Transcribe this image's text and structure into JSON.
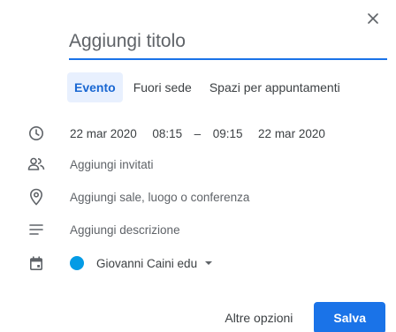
{
  "dialog": {
    "close_label": "×",
    "title_placeholder": "Aggiungi titolo"
  },
  "tabs": [
    {
      "label": "Evento",
      "active": true
    },
    {
      "label": "Fuori sede",
      "active": false
    },
    {
      "label": "Spazi per appuntamenti",
      "active": false
    }
  ],
  "datetime": {
    "start_date": "22 mar 2020",
    "start_time": "08:15",
    "separator": "–",
    "end_time": "09:15",
    "end_date": "22 mar 2020"
  },
  "guests": {
    "placeholder": "Aggiungi invitati"
  },
  "location": {
    "placeholder": "Aggiungi sale, luogo o conferenza"
  },
  "description": {
    "placeholder": "Aggiungi descrizione"
  },
  "calendar": {
    "name": "Giovanni Caini edu",
    "color": "#039be5"
  },
  "footer": {
    "more_options_label": "Altre opzioni",
    "save_label": "Salva"
  },
  "colors": {
    "accent": "#1a73e8",
    "active_tab_bg": "#e8f0fe",
    "active_tab_text": "#1967d2"
  },
  "icons": {
    "clock": "clock-icon",
    "guests": "people-icon",
    "location": "location-pin-icon",
    "description": "text-lines-icon",
    "calendar": "calendar-icon",
    "close": "close-icon",
    "dropdown": "caret-down-icon"
  }
}
